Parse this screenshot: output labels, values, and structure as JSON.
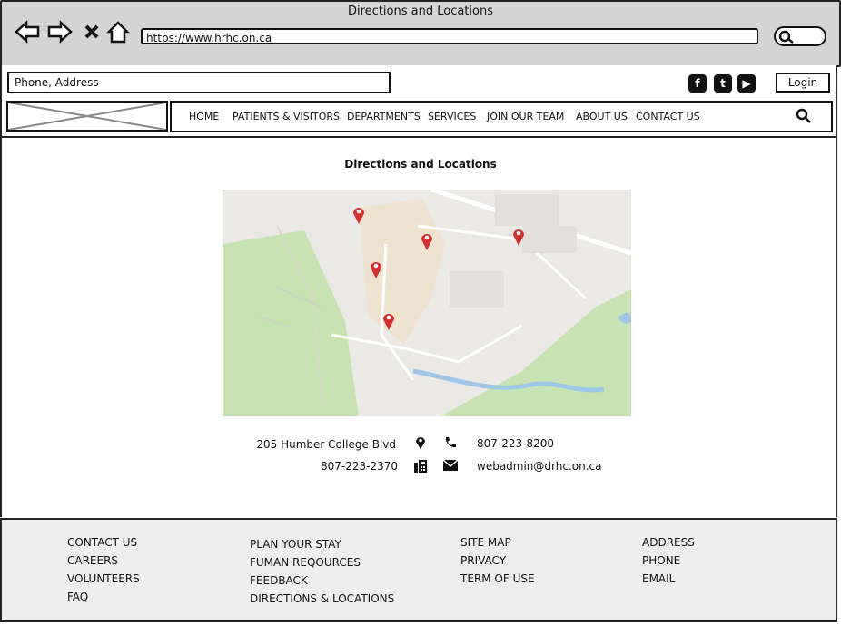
{
  "browser": {
    "window_title": "Directions and Locations",
    "url": "https://www.hrhc.on.ca",
    "nav_icons": [
      "back-arrow-icon",
      "forward-arrow-icon",
      "close-icon",
      "home-icon"
    ]
  },
  "header": {
    "search_placeholder": "Phone, Address",
    "social": [
      {
        "name": "facebook-icon",
        "glyph": "f"
      },
      {
        "name": "twitter-icon",
        "glyph": "t"
      },
      {
        "name": "youtube-icon",
        "glyph": "▶"
      }
    ],
    "login_label": "Login"
  },
  "nav": {
    "items": [
      "HOME",
      "PATIENTS & VISITORS",
      "DEPARTMENTS",
      "SERVICES",
      "JOIN OUR TEAM",
      "ABOUT US",
      "CONTACT US"
    ]
  },
  "main": {
    "title": "Directions and Locations",
    "address": "205 Humber College Blvd",
    "phone": "807-223-8200",
    "fax": "807-223-2370",
    "email": "webadmin@drhc.on.ca",
    "map_pin_color": "#e0322a"
  },
  "footer": {
    "col1": [
      "CONTACT US",
      "CAREERS",
      "VOLUNTEERS",
      "FAQ"
    ],
    "col2": [
      "PLAN YOUR STAY",
      "FUMAN REQOURCES",
      "FEEDBACK",
      "DIRECTIONS & LOCATIONS"
    ],
    "col3": [
      "SITE MAP",
      "PRIVACY",
      "TERM OF USE"
    ],
    "col4": [
      "ADDRESS",
      "PHONE",
      "EMAIL"
    ]
  }
}
